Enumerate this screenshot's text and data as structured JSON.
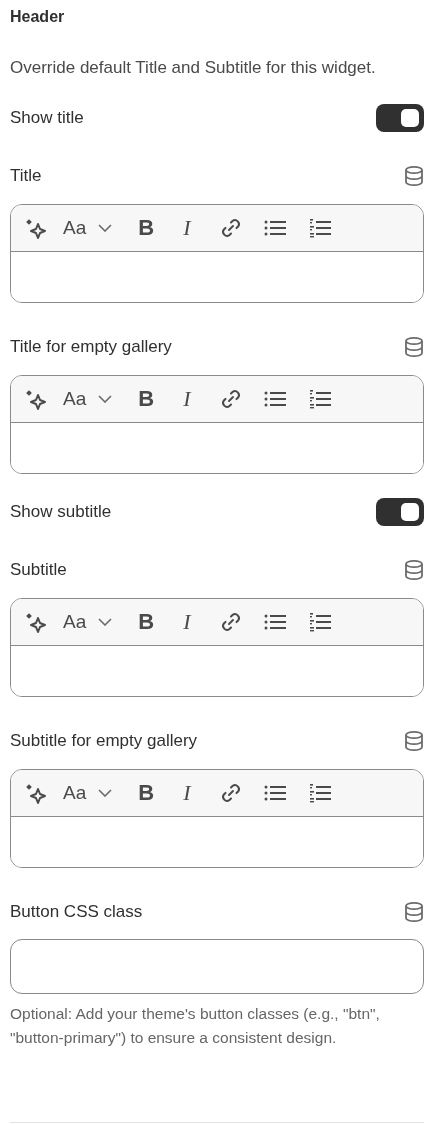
{
  "header": {
    "title": "Header",
    "description": "Override default Title and Subtitle for this widget."
  },
  "fields": [
    {
      "kind": "toggle",
      "label": "Show title",
      "on": true
    },
    {
      "kind": "richtext",
      "label": "Title",
      "toolbar": {
        "font_label": "Aa",
        "bold_glyph": "B",
        "italic_glyph": "I"
      }
    },
    {
      "kind": "richtext",
      "label": "Title for empty gallery",
      "toolbar": {
        "font_label": "Aa",
        "bold_glyph": "B",
        "italic_glyph": "I"
      }
    },
    {
      "kind": "toggle",
      "label": "Show subtitle",
      "on": true
    },
    {
      "kind": "richtext",
      "label": "Subtitle",
      "toolbar": {
        "font_label": "Aa",
        "bold_glyph": "B",
        "italic_glyph": "I"
      }
    },
    {
      "kind": "richtext",
      "label": "Subtitle for empty gallery",
      "toolbar": {
        "font_label": "Aa",
        "bold_glyph": "B",
        "italic_glyph": "I"
      }
    },
    {
      "kind": "text",
      "label": "Button CSS class",
      "help": "Optional: Add your theme's button classes (e.g., \"btn\", \"button-primary\") to ensure a consistent design."
    }
  ]
}
